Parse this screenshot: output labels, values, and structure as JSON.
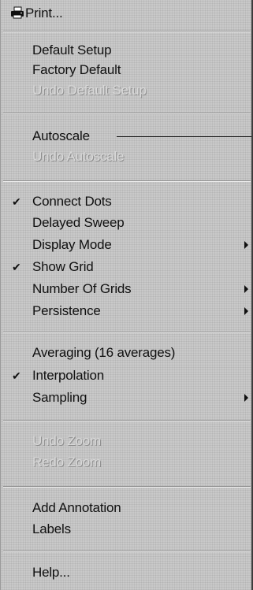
{
  "menu": {
    "print": "Print...",
    "default_setup": "Default Setup",
    "factory_default": "Factory Default",
    "undo_default_setup": "Undo Default Setup",
    "autoscale": "Autoscale",
    "undo_autoscale": "Undo Autoscale",
    "connect_dots": "Connect Dots",
    "delayed_sweep": "Delayed Sweep",
    "display_mode": "Display Mode",
    "show_grid": "Show Grid",
    "number_of_grids": "Number Of Grids",
    "persistence": "Persistence",
    "averaging": "Averaging (16 averages)",
    "interpolation": "Interpolation",
    "sampling": "Sampling",
    "undo_zoom": "Undo Zoom",
    "redo_zoom": "Redo Zoom",
    "add_annotation": "Add Annotation",
    "labels": "Labels",
    "help": "Help..."
  },
  "state": {
    "checked": [
      "connect_dots",
      "show_grid",
      "interpolation"
    ],
    "disabled": [
      "undo_default_setup",
      "undo_autoscale",
      "undo_zoom",
      "redo_zoom"
    ],
    "submenus": [
      "display_mode",
      "number_of_grids",
      "persistence",
      "sampling"
    ]
  },
  "icons": {
    "print": "printer-icon",
    "check": "checkmark-icon",
    "submenu": "submenu-arrow-icon"
  }
}
